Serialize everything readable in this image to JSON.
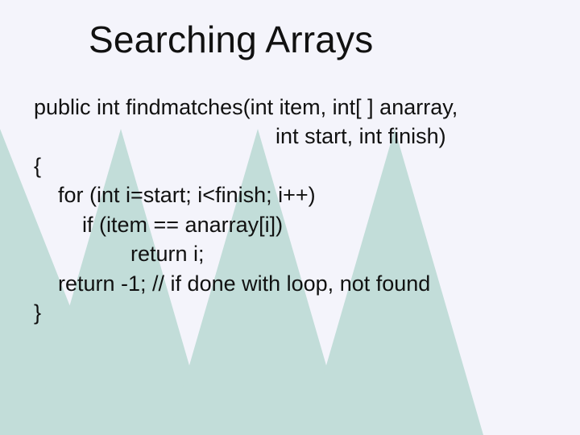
{
  "title": "Searching Arrays",
  "code": {
    "l1": "public int findmatches(int item, int[ ] anarray,",
    "l2": "                                        int start, int finish)",
    "l3": "{",
    "l4": "    for (int i=start; i<finish; i++)",
    "l5": "        if (item == anarray[i])",
    "l6": "                return i;",
    "l7": "    return -1; // if done with loop, not found",
    "l8": "}"
  }
}
